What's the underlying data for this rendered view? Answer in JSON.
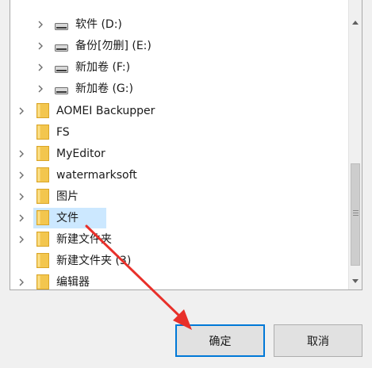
{
  "tree": {
    "drives": [
      {
        "label": "软件 (D:)"
      },
      {
        "label": "备份[勿删] (E:)"
      },
      {
        "label": "新加卷 (F:)"
      },
      {
        "label": "新加卷 (G:)"
      }
    ],
    "folders": [
      {
        "label": "AOMEI Backupper",
        "expandable": true
      },
      {
        "label": "FS",
        "expandable": false
      },
      {
        "label": "MyEditor",
        "expandable": true
      },
      {
        "label": "watermarksoft",
        "expandable": true
      },
      {
        "label": "图片",
        "expandable": true
      },
      {
        "label": "文件",
        "expandable": true,
        "selected": true
      },
      {
        "label": "新建文件夹",
        "expandable": true
      },
      {
        "label": "新建文件夹 (3)",
        "expandable": false
      },
      {
        "label": "编辑器",
        "expandable": true
      }
    ]
  },
  "buttons": {
    "confirm_label": "确定",
    "cancel_label": "取消"
  },
  "colors": {
    "folder": "#f3c64e",
    "selection": "#cce8ff",
    "annotation_arrow": "#e8302a",
    "focus_border": "#0078d7"
  }
}
